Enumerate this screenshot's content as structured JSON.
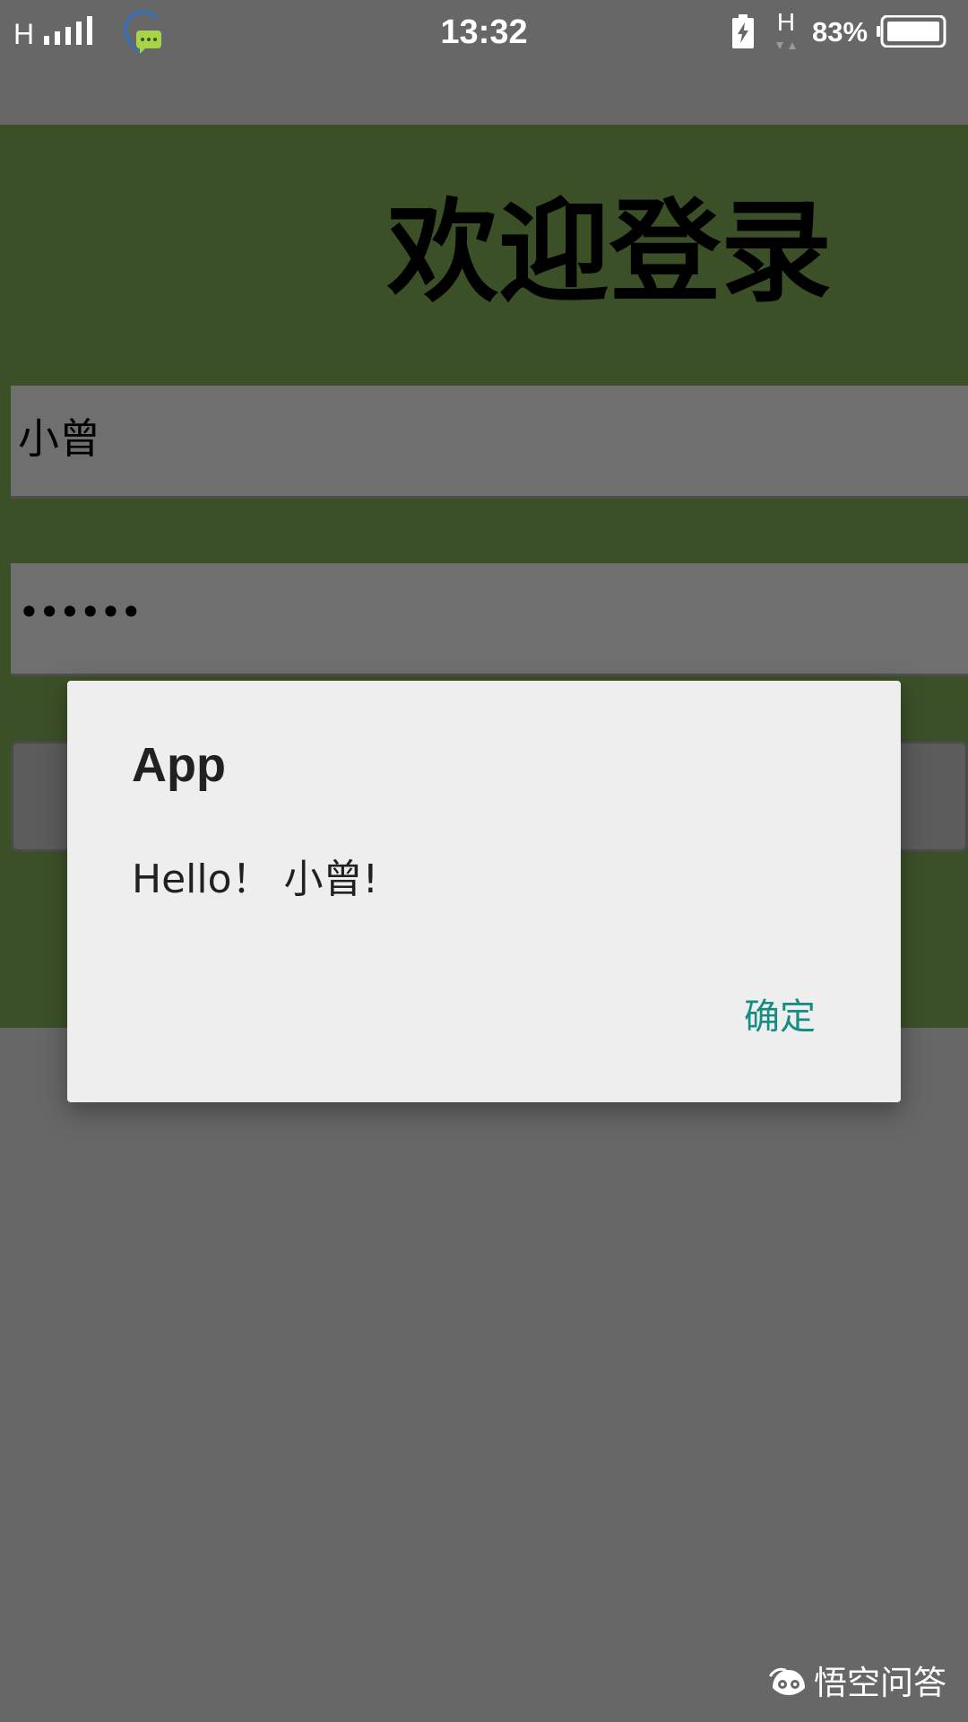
{
  "status_bar": {
    "network_type": "H",
    "clock": "13:32",
    "network_type_secondary": "H",
    "battery_percent": "83%",
    "chat_icon": "chat-bubble-icon",
    "charge_icon": "lightning-charge-icon"
  },
  "login": {
    "welcome_title": "欢迎登录",
    "username_value": "小曾",
    "password_value": "••••••",
    "background_color": "#3c5028"
  },
  "dialog": {
    "title": "App",
    "message": "Hello！ 小曾!",
    "confirm_label": "确定",
    "accent_color": "#168d83"
  },
  "watermark": {
    "text": "悟空问答"
  }
}
